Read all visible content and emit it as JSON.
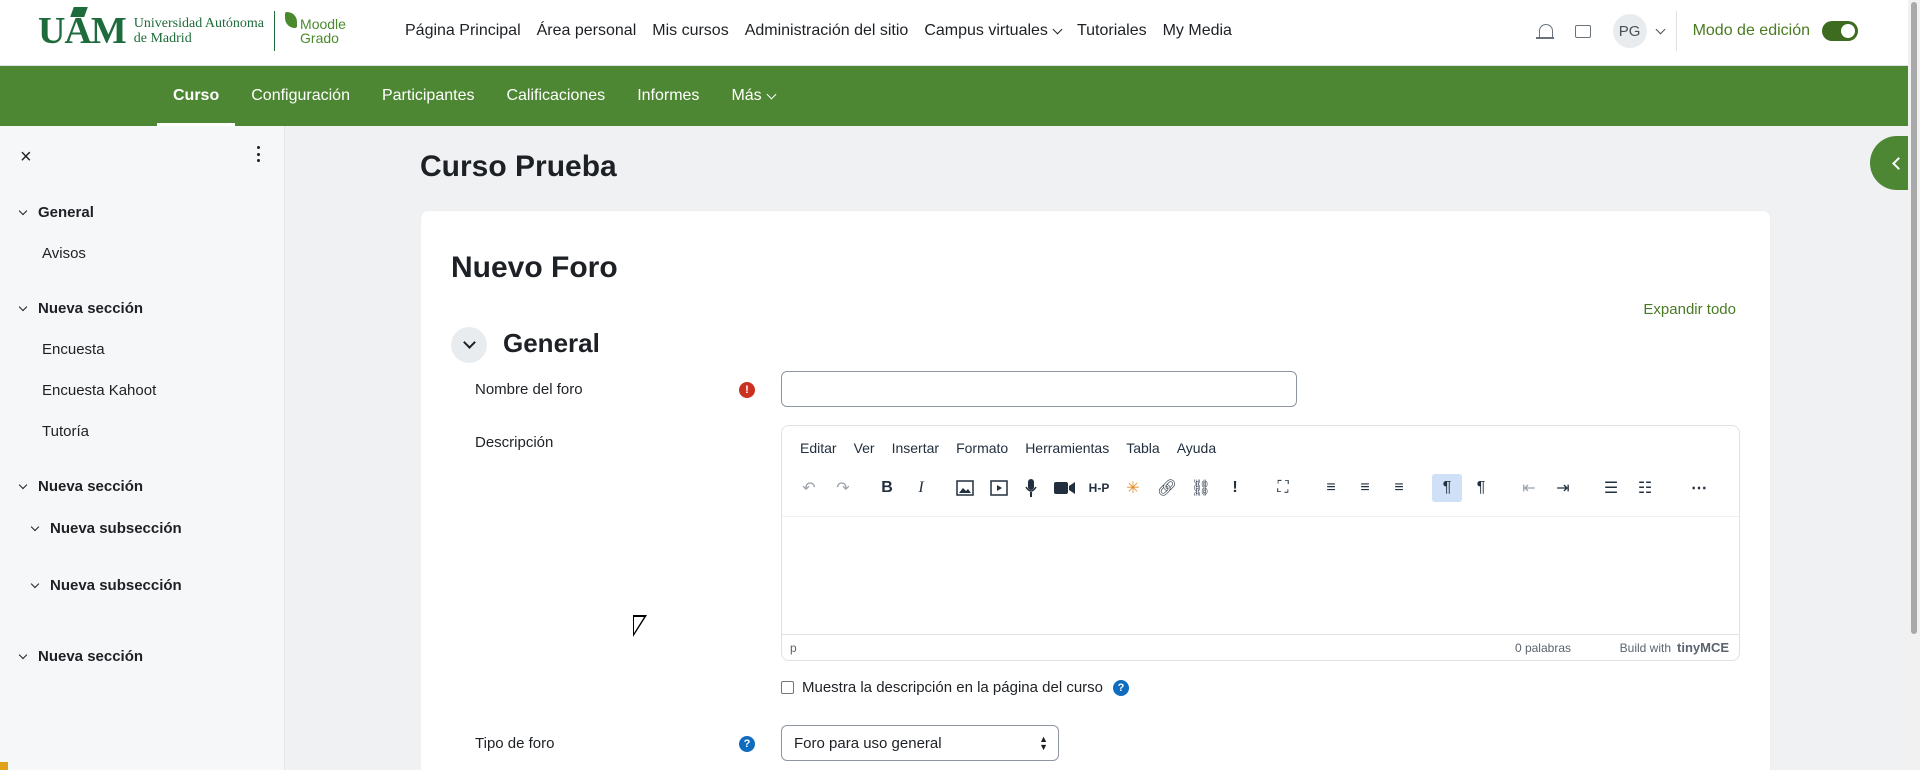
{
  "header": {
    "logo": {
      "brand": "UAM",
      "line1": "Universidad Autónoma",
      "line2": "de Madrid",
      "moodle1": "Moodle",
      "moodle2": "Grado"
    },
    "nav": [
      "Página Principal",
      "Área personal",
      "Mis cursos",
      "Administración del sitio",
      "Campus virtuales",
      "Tutoriales",
      "My Media"
    ],
    "avatar_initials": "PG",
    "edit_mode_label": "Modo de edición"
  },
  "course_nav": {
    "tabs": [
      "Curso",
      "Configuración",
      "Participantes",
      "Calificaciones",
      "Informes",
      "Más"
    ]
  },
  "drawer": {
    "close_icon": "×",
    "items": [
      {
        "label": "General",
        "type": "section"
      },
      {
        "label": "Avisos",
        "type": "activity"
      },
      {
        "label": "Nueva sección",
        "type": "section"
      },
      {
        "label": "Encuesta",
        "type": "activity"
      },
      {
        "label": "Encuesta Kahoot",
        "type": "activity"
      },
      {
        "label": "Tutoría",
        "type": "activity"
      },
      {
        "label": "Nueva sección",
        "type": "section"
      },
      {
        "label": "Nueva subsección",
        "type": "subsection"
      },
      {
        "label": "Nueva subsección",
        "type": "subsection"
      },
      {
        "label": "Nueva sección",
        "type": "section"
      }
    ]
  },
  "page": {
    "course_title": "Curso Prueba",
    "form_title": "Nuevo Foro",
    "expand_all": "Expandir todo",
    "section_title": "General"
  },
  "form": {
    "name_label": "Nombre del foro",
    "name_value": "",
    "description_label": "Descripción",
    "editor_menu": [
      "Editar",
      "Ver",
      "Insertar",
      "Formato",
      "Herramientas",
      "Tabla",
      "Ayuda"
    ],
    "status_path": "p",
    "word_count": "0 palabras",
    "build_with": "Build with",
    "tinymce": "tinyMCE",
    "show_description_label": "Muestra la descripción en la página del curso",
    "forum_type_label": "Tipo de foro",
    "forum_type_value": "Foro para uso general"
  },
  "icons": {
    "required": "!",
    "help": "?"
  },
  "colors": {
    "primary_green": "#4e8733",
    "accent_link": "#4a7a23",
    "required_red": "#ca3120",
    "help_blue": "#0f6cbf"
  }
}
